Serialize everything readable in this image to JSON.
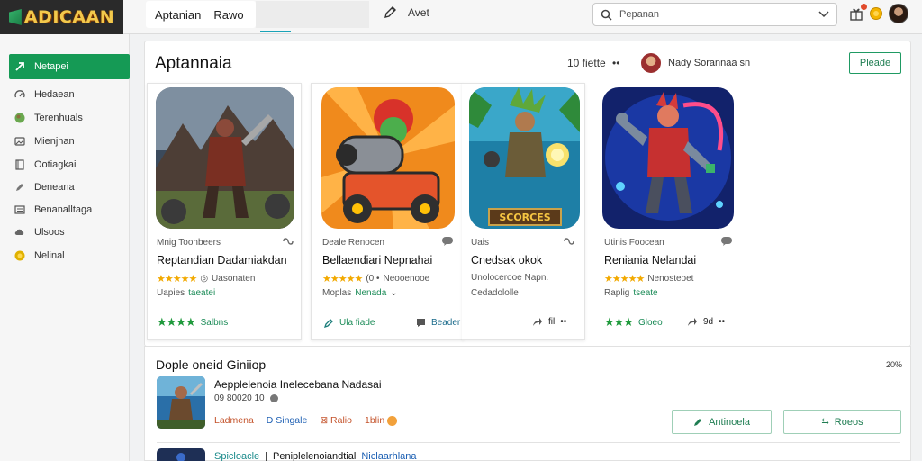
{
  "app": {
    "logo_text": "ADICAAN"
  },
  "header": {
    "tabs": [
      "Aptanian",
      "Rawo"
    ],
    "edit_label": "Avet",
    "search": {
      "value": "Pepanan",
      "placeholder": "Pepanan"
    },
    "notification_badge_color": "#e14a2b"
  },
  "sidebar": {
    "items": [
      {
        "label": "Netapei",
        "icon": "arrow-icon"
      },
      {
        "label": "Hedaean",
        "icon": "gauge-icon"
      },
      {
        "label": "Terenhuals",
        "icon": "globe-icon"
      },
      {
        "label": "Mienjnan",
        "icon": "image-icon"
      },
      {
        "label": "Ootiagkai",
        "icon": "book-icon"
      },
      {
        "label": "Deneana",
        "icon": "edit-icon"
      },
      {
        "label": "Benanalltaga",
        "icon": "list-icon"
      },
      {
        "label": "Ulsoos",
        "icon": "cloud-icon"
      },
      {
        "label": "Nelinal",
        "icon": "coin-icon"
      }
    ]
  },
  "main": {
    "title": "Aptannaia",
    "filter_count": "10 fiette",
    "user_name": "Nady Sorannaa sn",
    "action_label": "Pleade"
  },
  "cards": [
    {
      "subtitle": "Mnig Toonbeers",
      "title": "Reptandian Dadamiakdan",
      "rating_stars": "★★★★★",
      "rating_text": "Uasonaten",
      "meta2_prefix": "Uapies",
      "meta2_link": "taeatei",
      "foot_stars": "★★★★",
      "foot_text": "Salbns"
    },
    {
      "subtitle": "Deale Renocen",
      "title": "Bellaendiari Nepnahai",
      "rating_stars": "★★★★★",
      "rating_text": "Neooenooe",
      "meta2_prefix": "Moplas",
      "meta2_link": "Nenada",
      "foot_link_left": "Ula fiade",
      "foot_link_right": "Beader",
      "foot_share": "fil"
    },
    {
      "subtitle": "Uais",
      "title": "Cnedsak okok",
      "rating_text": "Unolocerooe Napn.",
      "meta2_prefix": "Cedadololle"
    },
    {
      "subtitle": "Utinis Foocean",
      "title": "Reniania Nelandai",
      "rating_stars": "★★★★★",
      "rating_text": "Nenosteoet",
      "meta2_prefix": "Raplig",
      "meta2_link": "tseate",
      "foot_stars": "★★★",
      "foot_text": "Gloeo",
      "foot_share": "9d"
    }
  ],
  "thumb_caption": "SCORCES",
  "bottom": {
    "section_title": "Dople oneid Giniiop",
    "section_count": "20%",
    "item": {
      "title": "Aepplelenoia Inelecebana Nadasai",
      "meta": "09 80020 10",
      "action_red": "Ladmena",
      "action_blue": "Singale",
      "action_orange": "Ralio",
      "action_count": "1blin",
      "btn_primary": "Antinoela",
      "btn_secondary": "Roeos"
    },
    "row2": {
      "link": "Spicloacle",
      "text": "Peniplelenoiandtial",
      "tag": "Niclaarhlana"
    }
  },
  "colors": {
    "brand_green": "#159a55",
    "accent_teal": "#1aa3b8",
    "star_yellow": "#f2a900",
    "link_green": "#1b8b57"
  }
}
